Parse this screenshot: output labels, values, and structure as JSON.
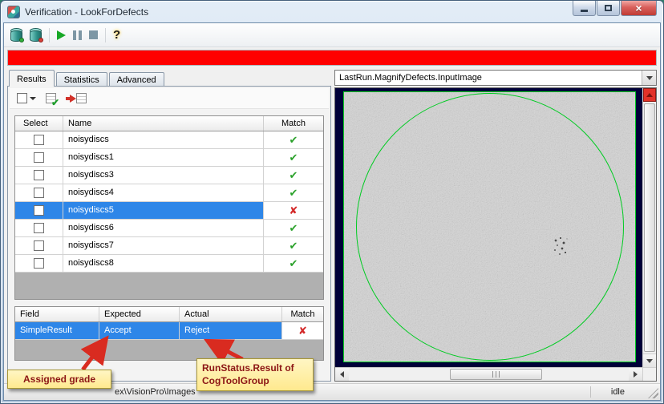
{
  "window": {
    "title": "Verification - LookForDefects"
  },
  "icons": {
    "pass": "✔",
    "fail": "✘",
    "help": "?",
    "close": "×",
    "mini_check": "✔"
  },
  "progress_bar": {
    "color": "#ff0000",
    "state": "full"
  },
  "tabs": {
    "items": [
      {
        "label": "Results"
      },
      {
        "label": "Statistics"
      },
      {
        "label": "Advanced"
      }
    ],
    "active": "Results"
  },
  "results_table": {
    "headers": [
      "Select",
      "Name",
      "Match"
    ],
    "rows": [
      {
        "name": "noisydiscs",
        "match": "pass",
        "checked": false,
        "selected": false
      },
      {
        "name": "noisydiscs1",
        "match": "pass",
        "checked": false,
        "selected": false
      },
      {
        "name": "noisydiscs3",
        "match": "pass",
        "checked": false,
        "selected": false
      },
      {
        "name": "noisydiscs4",
        "match": "pass",
        "checked": false,
        "selected": false
      },
      {
        "name": "noisydiscs5",
        "match": "fail",
        "checked": false,
        "selected": true
      },
      {
        "name": "noisydiscs6",
        "match": "pass",
        "checked": false,
        "selected": false
      },
      {
        "name": "noisydiscs7",
        "match": "pass",
        "checked": false,
        "selected": false
      },
      {
        "name": "noisydiscs8",
        "match": "pass",
        "checked": false,
        "selected": false
      }
    ]
  },
  "details_table": {
    "headers": [
      "Field",
      "Expected",
      "Actual",
      "Match"
    ],
    "row": {
      "field": "SimpleResult",
      "expected": "Accept",
      "actual": "Reject",
      "match": "fail",
      "selected": true
    }
  },
  "callouts": {
    "assigned_grade": "Assigned grade",
    "run_status": "RunStatus.Result of CogToolGroup"
  },
  "image_panel": {
    "selector_value": "LastRun.MagnifyDefects.InputImage"
  },
  "status_bar": {
    "path_fragment": "ex\\VisionPro\\Images",
    "state": "idle"
  },
  "colors": {
    "selection_blue": "#2e86e8",
    "pass_green": "#2aa12a",
    "fail_red": "#d42a2a",
    "callout_yellow": "#ffee9a",
    "display_background": "#000038",
    "overlay_green": "#00cc22",
    "progress_red": "#ff0000"
  }
}
